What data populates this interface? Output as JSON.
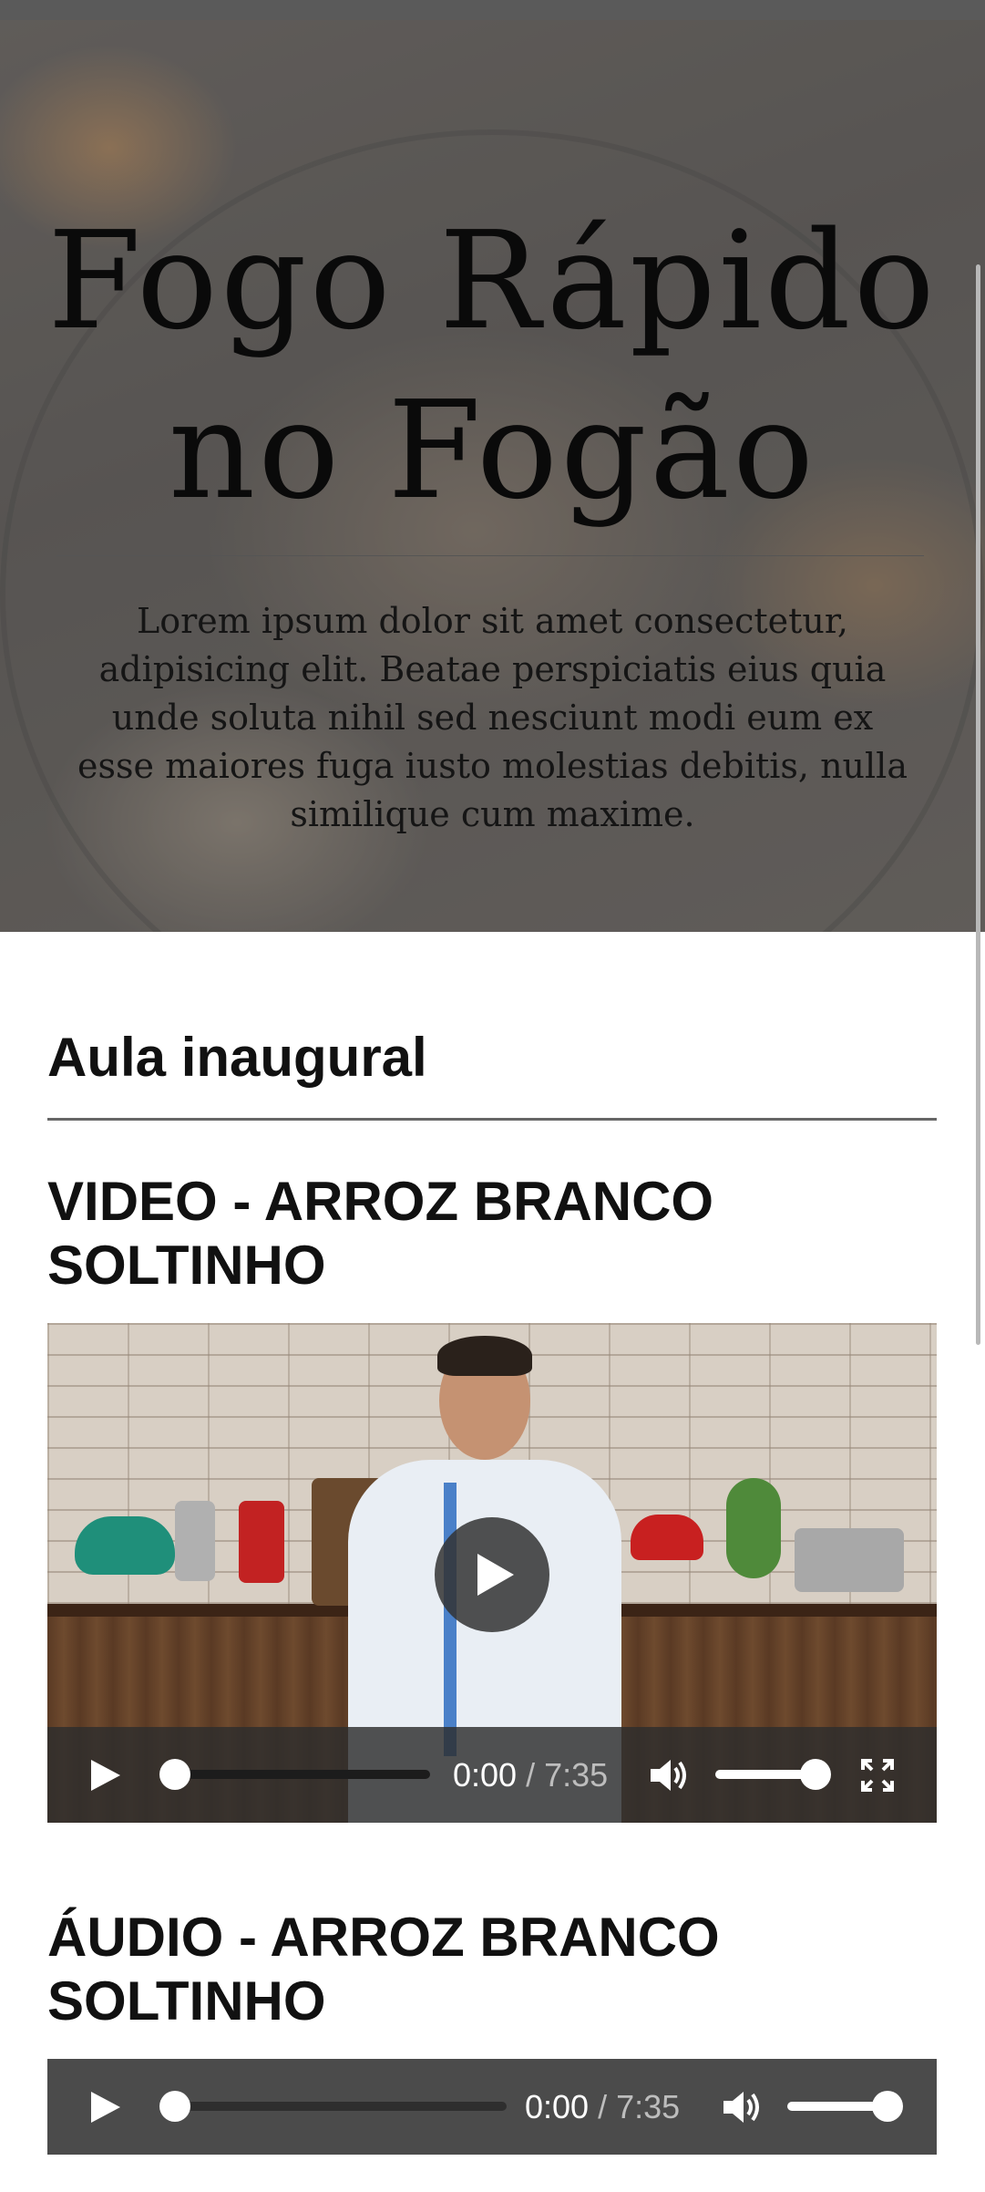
{
  "hero": {
    "title_line1": "Fogo Rápido",
    "title_line2": "no Fogão",
    "text": "Lorem ipsum dolor sit amet consectetur, adipisicing elit. Beatae perspiciatis eius quia unde soluta nihil sed nesciunt modi eum ex esse maiores fuga iusto molestias debitis, nulla similique cum maxime."
  },
  "section": {
    "title": "Aula inaugural"
  },
  "video": {
    "title_line1": "VIDEO - ARROZ BRANCO",
    "title_line2": "SOLTINHO",
    "current_time": "0:00",
    "separator": "/",
    "duration": "7:35",
    "progress": 0,
    "volume": 1.0,
    "icons": [
      "play-icon",
      "volume-icon",
      "fullscreen-icon"
    ]
  },
  "audio": {
    "title_line1": "ÁUDIO - ARROZ BRANCO",
    "title_line2": "SOLTINHO",
    "current_time": "0:00",
    "separator": "/",
    "duration": "7:35",
    "progress": 0,
    "volume": 1.0,
    "icons": [
      "play-icon",
      "volume-icon"
    ]
  },
  "colors": {
    "topbar": "#5a5a5a",
    "controls": "#4b4b4b",
    "accent": "#ffffff"
  }
}
